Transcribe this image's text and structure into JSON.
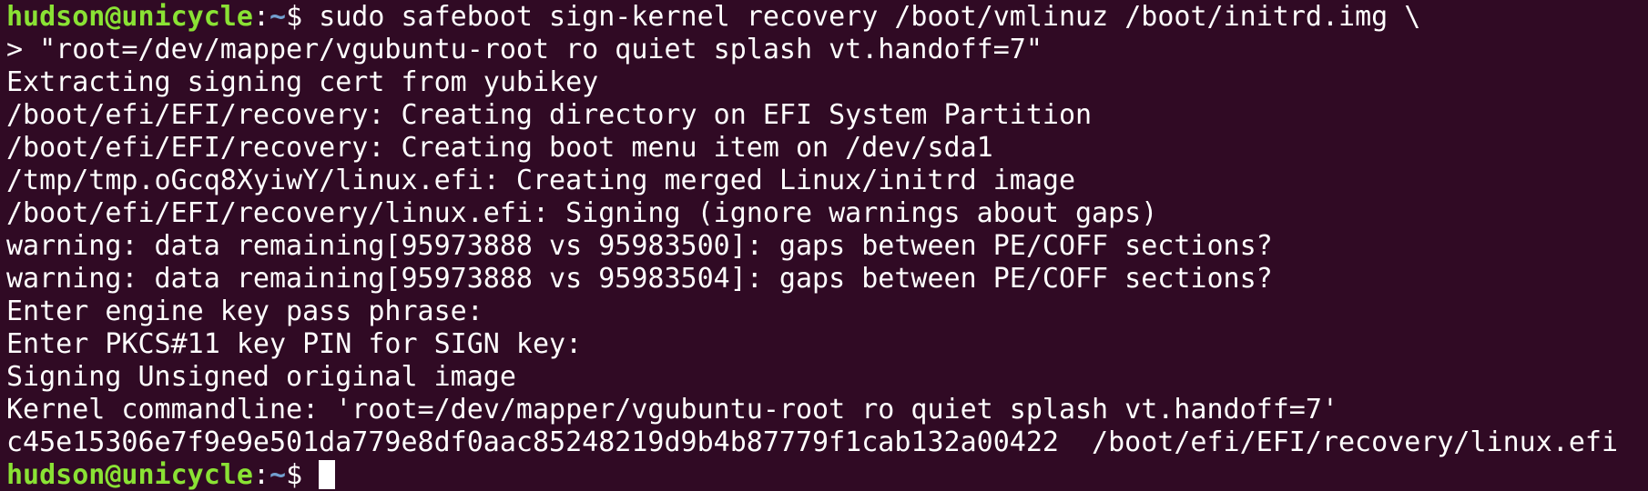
{
  "colors": {
    "background": "#300a24",
    "text": "#ffffff",
    "prompt_user": "#8ae234",
    "prompt_path": "#729fcf"
  },
  "prompt": {
    "user_host": "hudson@unicycle",
    "separator": ":",
    "path": "~",
    "symbol": "$ "
  },
  "command": {
    "text": "sudo safeboot sign-kernel recovery /boot/vmlinuz /boot/initrd.img \\",
    "continuation": "> \"root=/dev/mapper/vgubuntu-root ro quiet splash vt.handoff=7\""
  },
  "output": [
    "Extracting signing cert from yubikey",
    "/boot/efi/EFI/recovery: Creating directory on EFI System Partition",
    "/boot/efi/EFI/recovery: Creating boot menu item on /dev/sda1",
    "/tmp/tmp.oGcq8XyiwY/linux.efi: Creating merged Linux/initrd image",
    "/boot/efi/EFI/recovery/linux.efi: Signing (ignore warnings about gaps)",
    "warning: data remaining[95973888 vs 95983500]: gaps between PE/COFF sections?",
    "warning: data remaining[95973888 vs 95983504]: gaps between PE/COFF sections?",
    "Enter engine key pass phrase:",
    "Enter PKCS#11 key PIN for SIGN key:",
    "Signing Unsigned original image",
    "Kernel commandline: 'root=/dev/mapper/vgubuntu-root ro quiet splash vt.handoff=7'",
    "c45e15306e7f9e9e501da779e8df0aac85248219d9b4b87779f1cab132a00422  /boot/efi/EFI/recovery/linux.efi"
  ]
}
